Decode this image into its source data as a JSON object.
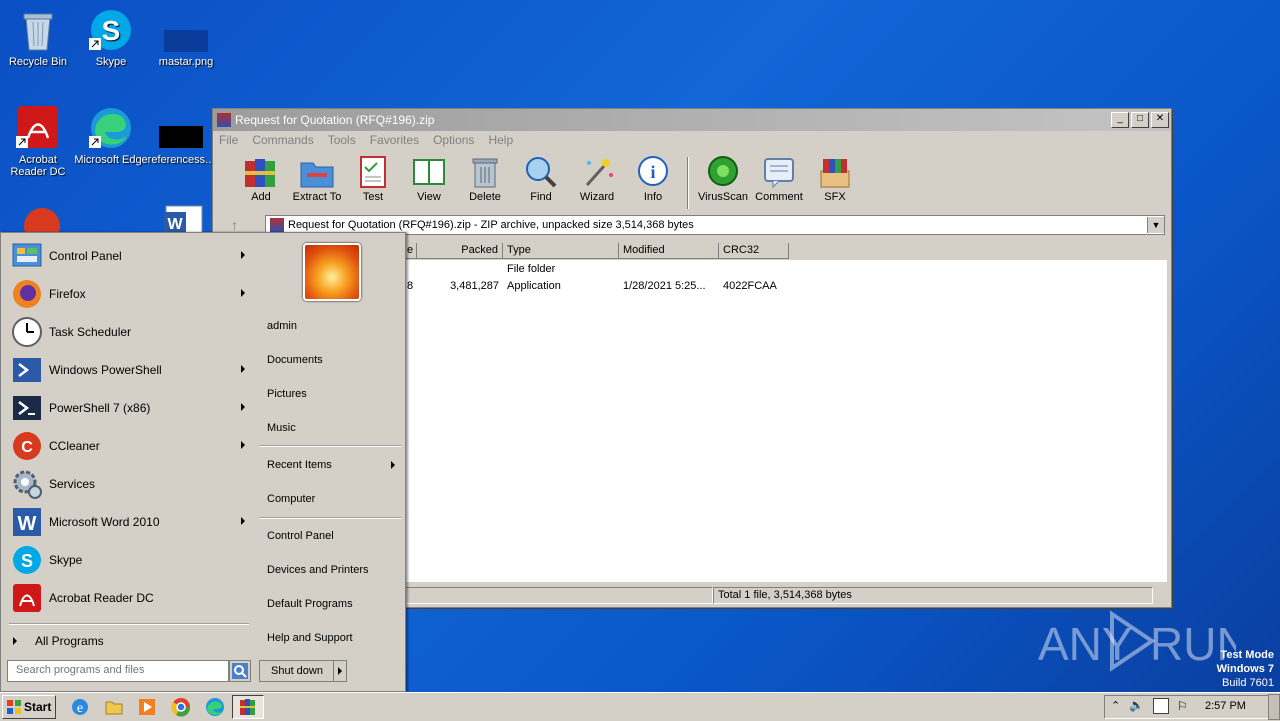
{
  "desktop": {
    "icons": [
      {
        "label": "Recycle Bin"
      },
      {
        "label": "Skype"
      },
      {
        "label": "mastar.png"
      },
      {
        "label": "Acrobat Reader DC"
      },
      {
        "label": "Microsoft Edge"
      },
      {
        "label": "referencess..."
      }
    ],
    "watermark": "ANY RUN",
    "test_mode": {
      "line1": "Test Mode",
      "line2": "Windows 7",
      "line3": "Build 7601"
    }
  },
  "winrar": {
    "title": "Request for Quotation (RFQ#196).zip",
    "menu": [
      "File",
      "Commands",
      "Tools",
      "Favorites",
      "Options",
      "Help"
    ],
    "toolbar": [
      "Add",
      "Extract To",
      "Test",
      "View",
      "Delete",
      "Find",
      "Wizard",
      "Info",
      "VirusScan",
      "Comment",
      "SFX"
    ],
    "path": "Request for Quotation (RFQ#196).zip - ZIP archive, unpacked size 3,514,368 bytes",
    "columns": [
      "e",
      "Packed",
      "Type",
      "Modified",
      "CRC32"
    ],
    "rows": [
      {
        "size": "",
        "packed": "",
        "type": "File folder",
        "modified": "",
        "crc": ""
      },
      {
        "size": "8",
        "packed": "3,481,287",
        "type": "Application",
        "modified": "1/28/2021 5:25...",
        "crc": "4022FCAA"
      }
    ],
    "status": "Total 1 file, 3,514,368 bytes"
  },
  "startmenu": {
    "left_items": [
      {
        "label": "Control Panel",
        "arrow": true
      },
      {
        "label": "Firefox",
        "arrow": true
      },
      {
        "label": "Task Scheduler",
        "arrow": false
      },
      {
        "label": "Windows PowerShell",
        "arrow": true
      },
      {
        "label": "PowerShell 7 (x86)",
        "arrow": true
      },
      {
        "label": "CCleaner",
        "arrow": true
      },
      {
        "label": "Services",
        "arrow": false
      },
      {
        "label": "Microsoft Word 2010",
        "arrow": true
      },
      {
        "label": "Skype",
        "arrow": false
      },
      {
        "label": "Acrobat Reader DC",
        "arrow": false
      }
    ],
    "all_programs": "All Programs",
    "search_placeholder": "Search programs and files",
    "right_items": [
      "admin",
      "Documents",
      "Pictures",
      "Music",
      "Recent Items",
      "Computer",
      "Control Panel",
      "Devices and Printers",
      "Default Programs",
      "Help and Support"
    ],
    "shutdown": "Shut down"
  },
  "taskbar": {
    "start": "Start",
    "clock": "2:57 PM"
  }
}
